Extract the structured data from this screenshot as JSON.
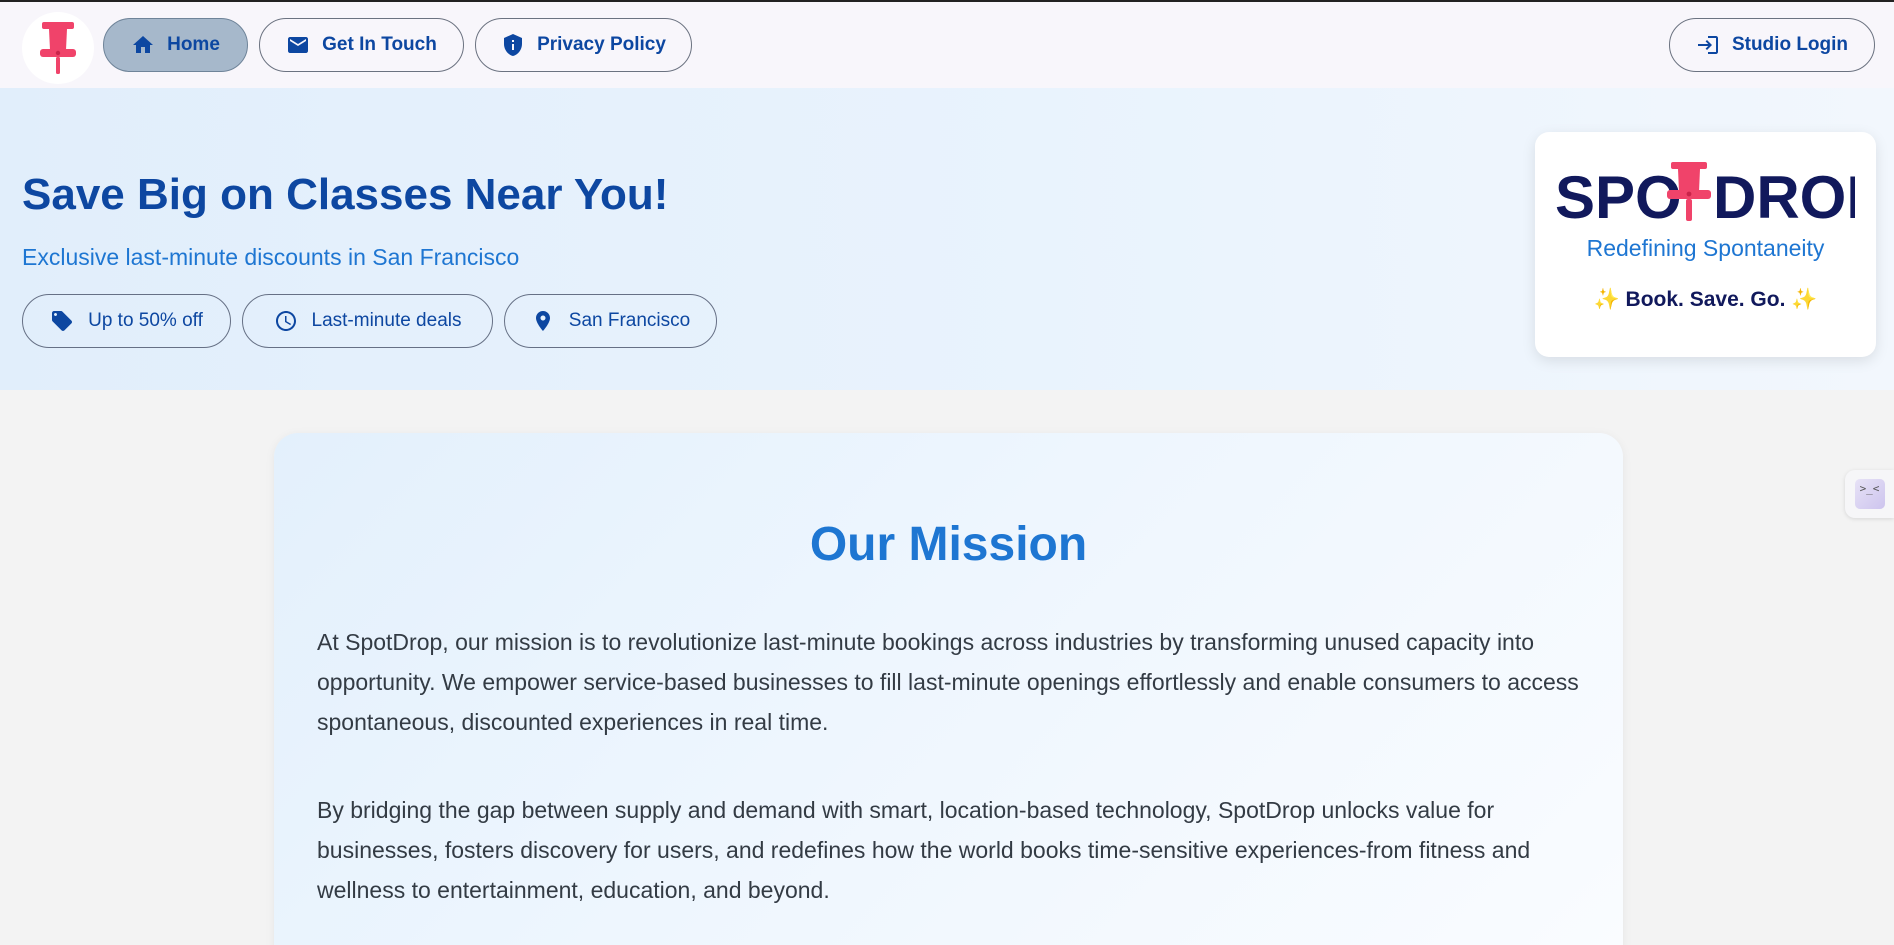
{
  "nav": {
    "logo_icon": "pushpin-icon",
    "home_label": "Home",
    "contact_label": "Get In Touch",
    "privacy_label": "Privacy Policy",
    "login_label": "Studio Login",
    "active_item": "home"
  },
  "hero": {
    "title": "Save Big on Classes Near You!",
    "subtitle": "Exclusive last-minute discounts in San Francisco",
    "chips": [
      {
        "label": "Up to 50% off",
        "icon": "tag-icon"
      },
      {
        "label": "Last-minute deals",
        "icon": "clock-icon"
      },
      {
        "label": "San Francisco",
        "icon": "location-pin-icon"
      }
    ]
  },
  "brand": {
    "wordmark_left": "SPO",
    "wordmark_right": "DROP",
    "tagline": "Redefining Spontaneity",
    "slogan_spark": "✨",
    "slogan": "Book. Save. Go."
  },
  "mission": {
    "title": "Our Mission",
    "paragraphs": [
      "At SpotDrop, our mission is to revolutionize last-minute bookings across industries by transforming unused capacity into opportunity. We empower service-based businesses to fill last-minute openings effortlessly and enable consumers to access spontaneous, discounted experiences in real time.",
      "By bridging the gap between supply and demand with smart, location-based technology, SpotDrop unlocks value for businesses, fosters discovery for users, and redefines how the world books time-sensitive experiences-from fitness and wellness to entertainment, education, and beyond."
    ]
  },
  "side_widget": {
    "glyph": ">_<"
  },
  "colors": {
    "primary": "#0d47a1",
    "accent": "#1e76d2",
    "pin": "#f0436a",
    "navy": "#11195c"
  }
}
